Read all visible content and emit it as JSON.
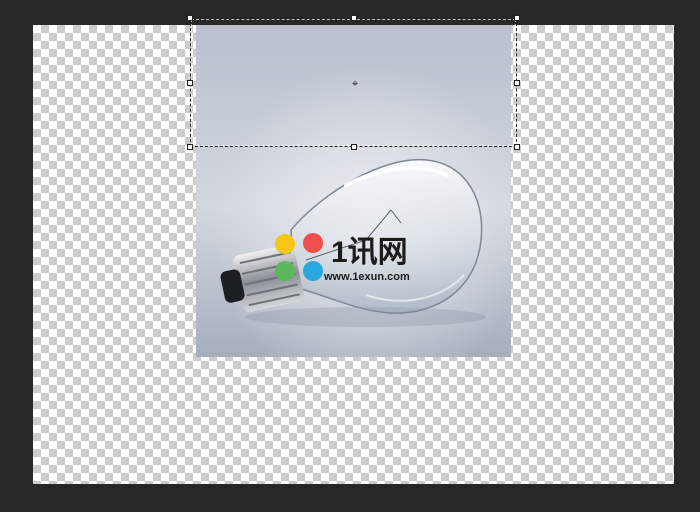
{
  "canvas": {
    "background": "transparent-checkerboard"
  },
  "image_layer": {
    "content": "light-bulb",
    "watermark": {
      "logo_text": "1讯网",
      "url_text": "www.1exun.com",
      "colors": [
        "#f5c518",
        "#ef4e4e",
        "#5cb85c",
        "#29a8e0"
      ]
    }
  },
  "selection": {
    "mode": "free-transform"
  },
  "icons": {
    "pivot": "pivot-icon"
  }
}
